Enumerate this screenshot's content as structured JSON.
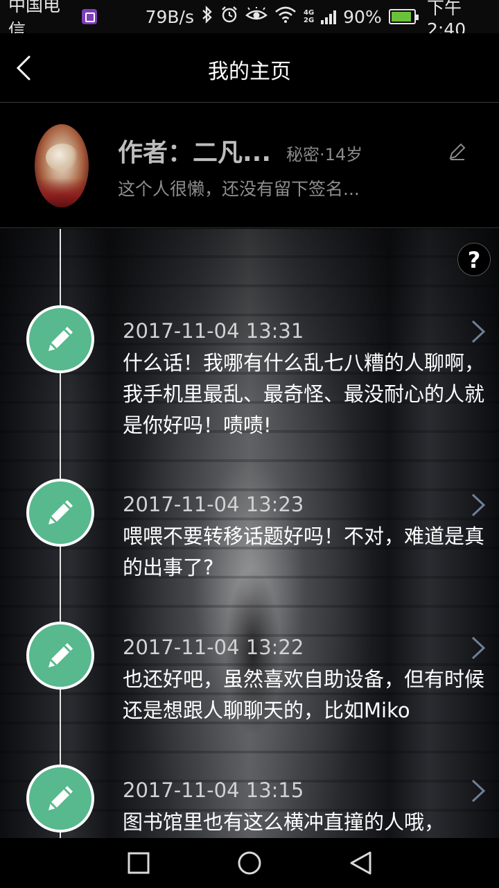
{
  "status_bar": {
    "carrier": "中国电信",
    "speed": "79B/s",
    "net_top": "4G",
    "net_bottom": "2G",
    "battery": "90%",
    "battery_level": 0.9,
    "time": "下午2:40"
  },
  "header": {
    "title": "我的主页"
  },
  "profile": {
    "name": "作者：二凡...",
    "meta": "秘密·14岁",
    "signature": "这个人很懒，还没有留下签名..."
  },
  "timeline": {
    "help_label": "?",
    "entries": [
      {
        "date": "2017-11-04 13:31",
        "text": "什么话！我哪有什么乱七八糟的人聊啊，我手机里最乱、最奇怪、最没耐心的人就是你好吗！啧啧!"
      },
      {
        "date": "2017-11-04 13:23",
        "text": "喂喂不要转移话题好吗！不对，难道是真的出事了?"
      },
      {
        "date": "2017-11-04 13:22",
        "text": "也还好吧，虽然喜欢自助设备，但有时候还是想跟人聊聊天的，比如Miko"
      },
      {
        "date": "2017-11-04 13:15",
        "text": "图书馆里也有这么横冲直撞的人哦，"
      }
    ]
  },
  "colors": {
    "accent": "#57b98d",
    "background": "#000000"
  }
}
